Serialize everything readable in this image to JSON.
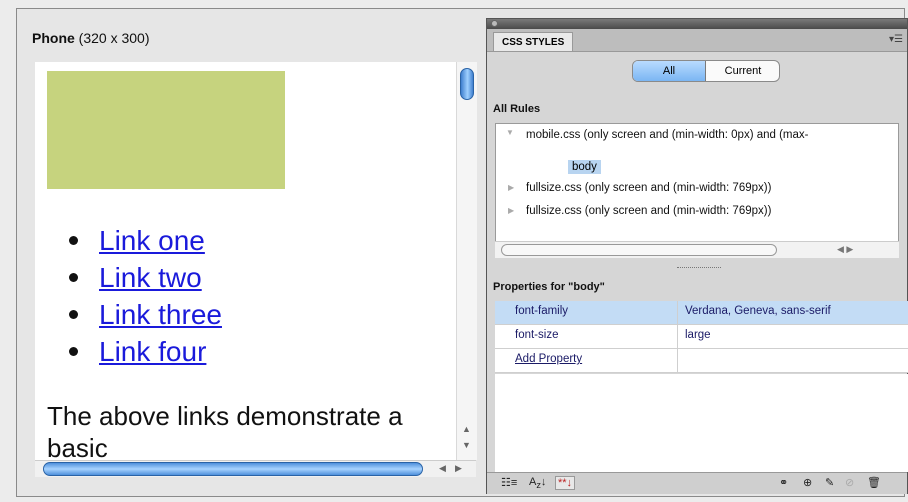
{
  "phone_preview": {
    "label_bold": "Phone",
    "label_size": "(320 x 300)",
    "links": [
      "Link one",
      "Link two",
      "Link three",
      "Link four"
    ],
    "paragraph": "The above links demonstrate a basic"
  },
  "css_panel": {
    "tab_label": "CSS STYLES",
    "mode_all": "All",
    "mode_current": "Current",
    "all_rules_heading": "All Rules",
    "rules": [
      "mobile.css (only screen and (min-width: 0px) and (max-",
      "fullsize.css (only screen and (min-width: 769px))",
      "fullsize.css (only screen and (min-width: 769px))"
    ],
    "selected_rule": "body",
    "properties_heading": "Properties for \"body\"",
    "properties": [
      {
        "name": "font-family",
        "value": "Verdana, Geneva, sans-serif"
      },
      {
        "name": "font-size",
        "value": "large"
      }
    ],
    "add_property": "Add Property"
  },
  "colors": {
    "green_box": "#c6d37e",
    "link": "#1a1adb",
    "selection": "#c3dcf5"
  }
}
